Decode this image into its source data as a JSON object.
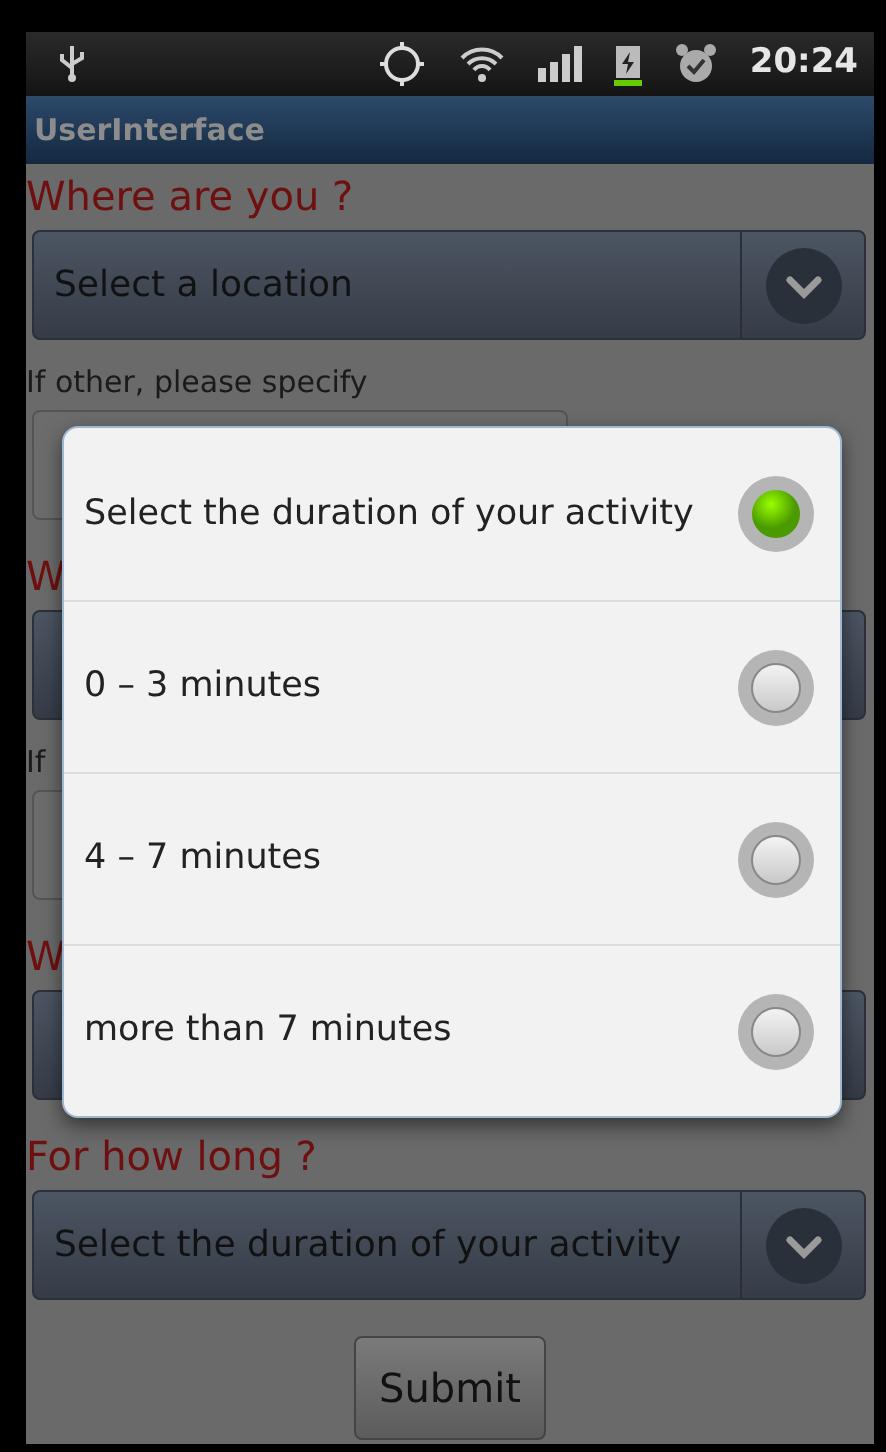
{
  "status_bar": {
    "time": "20:24"
  },
  "app_title": "UserInterface",
  "form": [
    {
      "kind": "label",
      "text": "Where are you ?"
    },
    {
      "kind": "spinner",
      "text": "Select a location"
    },
    {
      "kind": "hint",
      "text": "If other, please specify"
    },
    {
      "kind": "field"
    },
    {
      "kind": "label",
      "text": "W"
    },
    {
      "kind": "spinner"
    },
    {
      "kind": "hint",
      "text": "If"
    },
    {
      "kind": "field"
    },
    {
      "kind": "label",
      "text": "W"
    },
    {
      "kind": "spinner"
    },
    {
      "kind": "label",
      "text": "For how long ?"
    },
    {
      "kind": "spinner",
      "text": "Select the duration of your activity"
    }
  ],
  "submit": "Submit",
  "dialog": {
    "options": [
      {
        "label": "Select the duration of your activity",
        "selected": true
      },
      {
        "label": "0 – 3 minutes",
        "selected": false
      },
      {
        "label": "4 – 7 minutes",
        "selected": false
      },
      {
        "label": "more than 7 minutes",
        "selected": false
      }
    ]
  }
}
